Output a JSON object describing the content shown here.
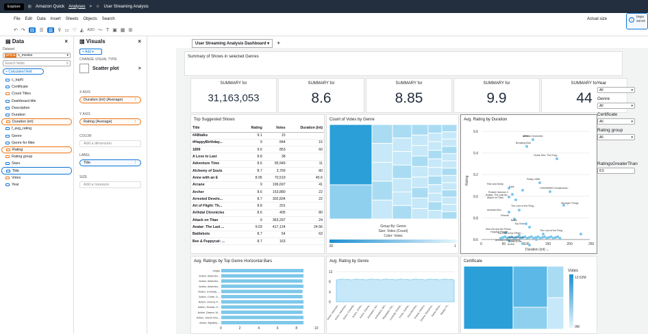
{
  "topbar": {
    "explore": "Explore",
    "brand": "Amazon Quick",
    "crumb_analyses": "Analyses",
    "crumb_sep": ">",
    "crumb_title": "User Streaming Analysis"
  },
  "menu": {
    "items": [
      "File",
      "Edit",
      "Data",
      "Insert",
      "Sheets",
      "Objects",
      "Search"
    ],
    "right": "Actual size"
  },
  "toast": {
    "title": "Impo",
    "body": "succe"
  },
  "toolbar": {
    "undo": "↶",
    "redo": "↷",
    "add": "ADD"
  },
  "data_panel": {
    "title": "Data",
    "close": "×",
    "dataset_label": "Dataset",
    "dataset_tag": "SPICE",
    "dataset_name": "n_movies",
    "search_placeholder": "Search fields",
    "add_calc": "+ Calculated field",
    "fields": [
      {
        "label": "c_topN",
        "kind": "dim",
        "state": ""
      },
      {
        "label": "Certificate",
        "kind": "dim",
        "state": ""
      },
      {
        "label": "Count Titles",
        "kind": "measure",
        "state": ""
      },
      {
        "label": "Dashboard title",
        "kind": "dim",
        "state": ""
      },
      {
        "label": "Description",
        "kind": "dim",
        "state": ""
      },
      {
        "label": "Duration",
        "kind": "dim",
        "state": ""
      },
      {
        "label": "Duration (int)",
        "kind": "measure",
        "state": "sel"
      },
      {
        "label": "f_avg_rating",
        "kind": "dim",
        "state": ""
      },
      {
        "label": "Genre",
        "kind": "dim",
        "state": ""
      },
      {
        "label": "Genre for filter",
        "kind": "dim",
        "state": ""
      },
      {
        "label": "Rating",
        "kind": "measure",
        "state": "sel"
      },
      {
        "label": "Rating group",
        "kind": "measure",
        "state": ""
      },
      {
        "label": "Stars",
        "kind": "dim",
        "state": ""
      },
      {
        "label": "Title",
        "kind": "dim",
        "state": "sel2"
      },
      {
        "label": "Votes",
        "kind": "measure",
        "state": ""
      },
      {
        "label": "Year",
        "kind": "dim",
        "state": ""
      }
    ]
  },
  "visuals_panel": {
    "title": "Visuals",
    "close": "×",
    "add": "+ Add ▾",
    "change_label": "CHANGE VISUAL TYPE",
    "type": "Scatter plot",
    "chev": ">",
    "xaxis_label": "X AXIS",
    "xaxis_value": "Duration (int) (Average)",
    "yaxis_label": "Y AXIS",
    "yaxis_value": "Rating (Average)",
    "color_label": "COLOR",
    "color_value": "Add a dimension",
    "label_label": "LABEL",
    "label_value": "Title",
    "size_label": "SIZE",
    "size_value": "Add a measure"
  },
  "sheet": {
    "tab": "User Streaming Analysis Dashboard",
    "plus": "+"
  },
  "summary": {
    "text": "Summary of Shows in selected Genres"
  },
  "kpis": [
    {
      "label": "SUMMARY for",
      "value": "31,163,053"
    },
    {
      "label": "SUMMARY for",
      "value": "8.6"
    },
    {
      "label": "SUMMARY for",
      "value": "8.85"
    },
    {
      "label": "SUMMARY for",
      "value": "9.9"
    },
    {
      "label": "SUMMARY for",
      "value": "44"
    }
  ],
  "table": {
    "title": "Top Suggested Shows",
    "headers": [
      "Title",
      "Rating",
      "Votes",
      "Duration (int)"
    ],
    "rows": [
      [
        "#ABtalks",
        "9.1",
        "15",
        ""
      ],
      [
        "#HappyBirthday...",
        "9",
        "844",
        "15"
      ],
      [
        "1899",
        "9.6",
        "853",
        "60"
      ],
      [
        "A Love to Last",
        "8.8",
        "38",
        ""
      ],
      [
        "Adventure Time",
        "8.6",
        "95,949",
        "11"
      ],
      [
        "Alchemy of Souls",
        "8.7",
        "3,769",
        "80"
      ],
      [
        "Anne with an E",
        "8.95",
        "70,519",
        "45.6"
      ],
      [
        "Arcane",
        "9",
        "196,697",
        "41"
      ],
      [
        "Archer",
        "8.6",
        "153,880",
        "22"
      ],
      [
        "Arrested Develo...",
        "8.7",
        "302,834",
        "22"
      ],
      [
        "Art of Flight: Th...",
        "8.8",
        "201",
        ""
      ],
      [
        "Arthdal Chronicles",
        "8.6",
        "405",
        "80"
      ],
      [
        "Attack on Titan",
        "9",
        "363,297",
        "24"
      ],
      [
        "Avatar: The Last ...",
        "9.03",
        "417,124",
        "24.56"
      ],
      [
        "Battlebots",
        "8.7",
        "54",
        "63"
      ],
      [
        "Bee & Puppycat: ...",
        "8.7",
        "163",
        ""
      ]
    ]
  },
  "treemap": {
    "title": "Count of Votes by Genre",
    "group_by": "Group By: Genre",
    "size": "Size: Votes (Count)",
    "color": "Color: Votes",
    "min": "82",
    "max": "1"
  },
  "scatter": {
    "title": "Avg. Rating by Duration",
    "xlabel": "Duration (int)",
    "ylabel": "Rating",
    "labels": [
      "1899",
      "Breaking Bad",
      "Ozark Obo: The King...",
      "Peaky 1968",
      "Rick and Morty",
      "Dark",
      "CM15HM99 Fundamenta...",
      "Rocket Hammer 2",
      "Avatar: The Last Air...",
      "Attack on Titan",
      "Stranger Things",
      "The Lord of the Ring...",
      "Arrested Dev",
      "Friends",
      "Battle",
      "Top Gear",
      "Shin-Ra and the Prince",
      "Hospital Playlist",
      "The Lord of the Ring...",
      "The End of the FPMC...",
      "Hotel Del Luna",
      "Arrested Development",
      "Dead to Me",
      "Archer",
      "Arthdal Chronicles"
    ],
    "xticks": [
      "0",
      "50",
      "100",
      "150",
      "200",
      "250"
    ],
    "yticks": [
      "8.6",
      "8.8",
      "9.0",
      "9.2",
      "9.4",
      "9.6"
    ]
  },
  "controls": {
    "year_label": "Year",
    "year_value": "All",
    "genre_label": "Genre",
    "genre_value": "All",
    "cert_label": "Certificate",
    "cert_value": "All",
    "rg_label": "Rating group",
    "rg_value": "All",
    "rgt_label": "RatingsGreaterThan",
    "rgt_value": "8.5"
  },
  "hbar": {
    "title": "Avg. Ratings by Top Genre  Horizontal Bars",
    "categories": [
      "empty",
      "Action, Adventur...",
      "Action, Adventur...",
      "Action, Adventur...",
      "Action, Comedy, ...",
      "Action, Crime, D...",
      "Action, Drama, F...",
      "Action, Drama, H...",
      "Action, Drama, M...",
      "Action, Game-Sho...",
      "Action, Mystery,..."
    ],
    "values": [
      8.7,
      8.7,
      8.6,
      8.7,
      8.6,
      8.6,
      8.7,
      8.7,
      8.6,
      8.7,
      8.7
    ],
    "xticks": [
      "0",
      "2",
      "4",
      "6",
      "8",
      "10"
    ],
    "xlim": [
      0,
      10
    ]
  },
  "area": {
    "title": "Avg. Rating by Genre",
    "yticks": [
      "0",
      "4",
      "8",
      "12"
    ],
    "ylim": [
      0,
      12
    ],
    "xcats": [
      "Action, Adventur...",
      "Action, Adventur...",
      "Action, Comedy...",
      "Action, Crime...",
      "Action, Drama...",
      "Animation, Act...",
      "Animation, Adv...",
      "Biography, Doc...",
      "Comedy, Drama...",
      "Crime, Drama...",
      "Documentary...",
      "Drama, History...",
      "Drama, Romance...",
      "Game-Show...",
      "Reality-TV..."
    ]
  },
  "cert": {
    "title": "Certificate",
    "legend": "Votes",
    "max": "13.52M",
    "min": "0M"
  },
  "colors": {
    "accent": "#0972d3",
    "topbar": "#232f3e",
    "orange": "#ec7211",
    "chart": "#5cb8e6"
  }
}
